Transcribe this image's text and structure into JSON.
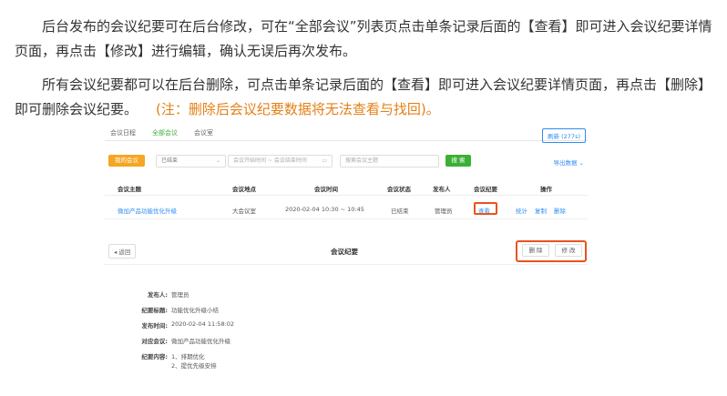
{
  "intro": {
    "p1": "后台发布的会议纪要可在后台修改，可在“全部会议”列表页点击单条记录后面的【查看】即可进入会议纪要详情页面，再点击【修改】进行编辑，确认无误后再次发布。",
    "p2": "所有会议纪要都可以在后台删除，可点击单条记录后面的【查看】即可进入会议纪要详情页面，再点击【删除】即可删除会议纪要。",
    "note": "(注：删除后会议纪要数据将无法查看与找回)。"
  },
  "tabs": [
    "会议日程",
    "全部会议",
    "会议室"
  ],
  "refresh": "刷新 (277s)",
  "filters": {
    "mine": "我的会议",
    "status": "已结束",
    "date": "会议开始时间 ~ 会议结束时间",
    "search": "搜索会议主题",
    "search_btn": "搜 索",
    "export": "导出数据"
  },
  "table": {
    "headers": [
      "会议主题",
      "会议地点",
      "会议时间",
      "会议状态",
      "发布人",
      "会议纪要",
      "操作"
    ],
    "row": {
      "subject": "微加产品功能优化升级",
      "place": "大会议室",
      "time": "2020-02-04 10:30 ~ 10:45",
      "status": "已结束",
      "publisher": "管理员",
      "minutes": "查看",
      "ops": [
        "统计",
        "复制",
        "删除"
      ]
    }
  },
  "detail": {
    "back": "返回",
    "title": "会议纪要",
    "delete": "删 除",
    "edit": "修 改",
    "fields": [
      {
        "label": "发布人:",
        "value": "管理员"
      },
      {
        "label": "纪要标题:",
        "value": "功能优化升级小结"
      },
      {
        "label": "发布时间:",
        "value": "2020-02-04 11:58:02"
      },
      {
        "label": "对应会议:",
        "value": "微加产品功能优化升级"
      },
      {
        "label": "纪要内容:",
        "value": "1、排期优化"
      },
      {
        "label": "",
        "value": "2、提优先级安排"
      }
    ]
  },
  "colors": {
    "accent": "#3cb035",
    "highlight": "#e8531e",
    "link": "#2d8cf0",
    "note": "#e38016"
  }
}
